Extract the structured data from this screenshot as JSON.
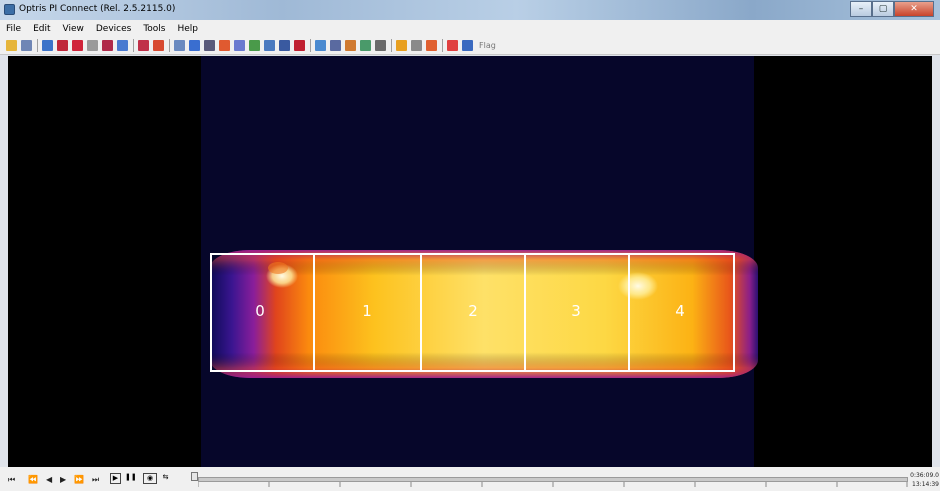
{
  "window": {
    "title": "Optris PI Connect (Rel. 2.5.2115.0)"
  },
  "menu": [
    "File",
    "Edit",
    "View",
    "Devices",
    "Tools",
    "Help"
  ],
  "toolbar": {
    "icons": [
      {
        "name": "open-icon",
        "color": "#e6b53a"
      },
      {
        "name": "save-icon",
        "color": "#6f86b5"
      },
      {
        "sep": true
      },
      {
        "name": "play-icon",
        "color": "#3b73c9"
      },
      {
        "name": "pause-icon",
        "color": "#c0283a"
      },
      {
        "name": "stop-icon",
        "color": "#d0243a"
      },
      {
        "name": "record-icon",
        "color": "#9a9a9a"
      },
      {
        "name": "snapshot-icon",
        "color": "#b02a4a"
      },
      {
        "name": "copy-icon",
        "color": "#4a7ad0"
      },
      {
        "sep": true
      },
      {
        "name": "layout-icon",
        "color": "#c03048"
      },
      {
        "name": "layout2-icon",
        "color": "#d84a30"
      },
      {
        "sep": true
      },
      {
        "name": "document-icon",
        "color": "#6a8ac0"
      },
      {
        "name": "histogram-icon",
        "color": "#3a6ed0"
      },
      {
        "name": "camera-icon",
        "color": "#5a5a7a"
      },
      {
        "name": "measure-icon",
        "color": "#e05a30"
      },
      {
        "name": "profile-icon",
        "color": "#6a7ad0"
      },
      {
        "name": "chart-icon",
        "color": "#4a9a4a"
      },
      {
        "name": "chart2-icon",
        "color": "#4a7ac0"
      },
      {
        "name": "grid-icon",
        "color": "#3a5aa0"
      },
      {
        "name": "dots-icon",
        "color": "#c02030"
      },
      {
        "sep": true
      },
      {
        "name": "fit-icon",
        "color": "#4a8ad0"
      },
      {
        "name": "zoom-icon",
        "color": "#5a6aa0"
      },
      {
        "name": "layout3-icon",
        "color": "#d07a30"
      },
      {
        "name": "compare-icon",
        "color": "#4a9a6a"
      },
      {
        "name": "tools-icon",
        "color": "#6a6a6a"
      },
      {
        "sep": true
      },
      {
        "name": "palette-icon",
        "color": "#e8a020"
      },
      {
        "name": "text-icon",
        "color": "#8a8a8a"
      },
      {
        "name": "color-icon",
        "color": "#e06030"
      },
      {
        "sep": true
      },
      {
        "name": "alarm-icon",
        "color": "#e04040"
      },
      {
        "name": "flag-icon",
        "color": "#3a6ac0"
      }
    ],
    "flag_label": "Flag"
  },
  "zones": [
    "0",
    "1",
    "2",
    "3",
    "4"
  ],
  "playback": {
    "buttons": [
      "⏮",
      "⏪",
      "◀",
      "▶",
      "⏩",
      "⏭"
    ],
    "time_top": "0:36:09.0",
    "time_bottom": "13:14:39"
  }
}
